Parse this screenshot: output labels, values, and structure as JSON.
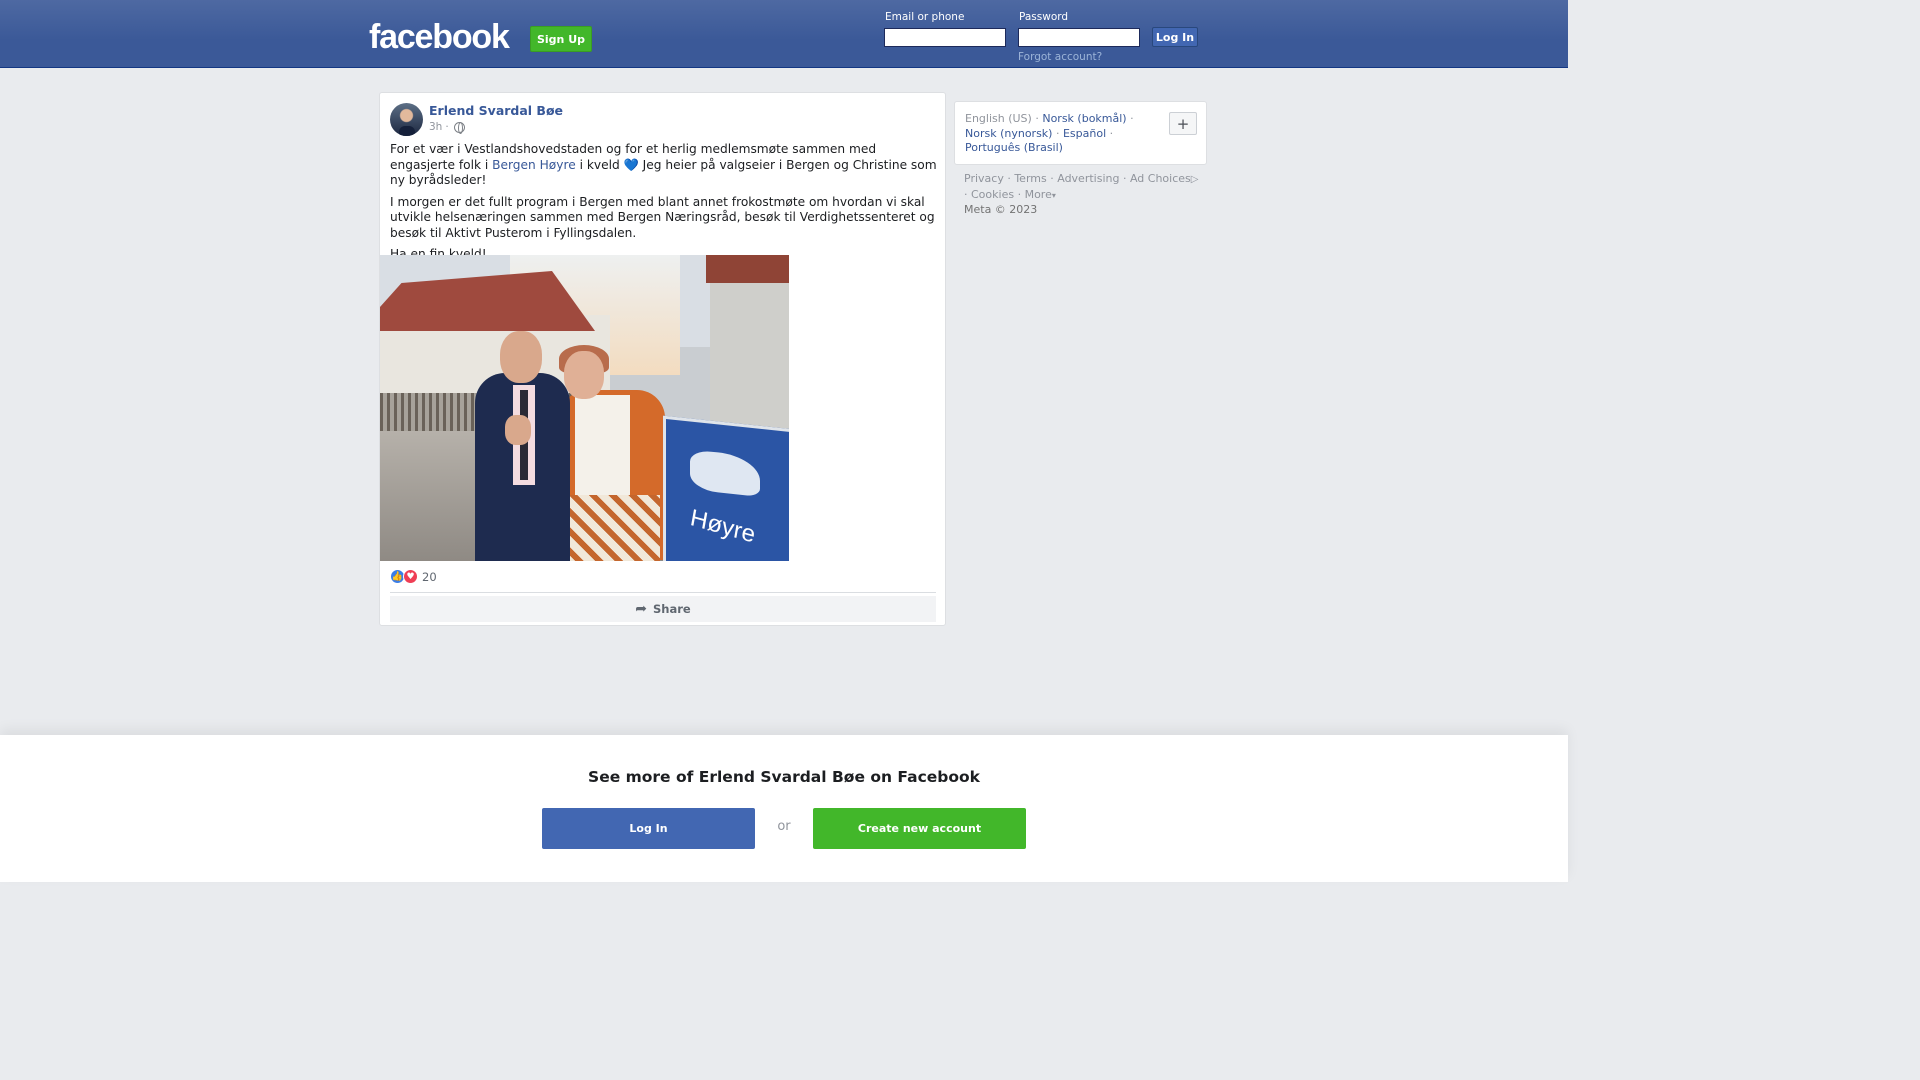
{
  "header": {
    "logo": "facebook",
    "signup_label": "Sign Up",
    "email_label": "Email or phone",
    "email_value": "",
    "password_label": "Password",
    "password_value": "",
    "login_label": "Log In",
    "forgot_label": "Forgot account?"
  },
  "post": {
    "author": "Erlend Svardal Bøe",
    "time": "3h",
    "separator": "·",
    "text_p1_before": "For et vær i Vestlandshovedstaden og for et herlig medlemsmøte sammen med engasjerte folk i ",
    "text_p1_link": "Bergen Høyre",
    "text_p1_mid": " i kveld ",
    "text_p1_emoji": "💙",
    "text_p1_after": " Jeg heier på valgseier i Bergen og Christine som ny byrådsleder!",
    "text_p2": "I morgen er det fullt program i Bergen med blant annet frokostmøte om hvordan vi skal utvikle helsenæringen sammen med Bergen Næringsråd, besøk til Verdighetssenteret og besøk til Aktivt Pusterom i Fyllingsdalen.",
    "text_p3": "Ha en fin kveld!",
    "photo_sign_text": "Høyre",
    "reaction_count": "20",
    "like_glyph": "👍",
    "love_glyph": "♥",
    "share_label": "Share",
    "share_glyph": "➦"
  },
  "sidebar": {
    "languages": [
      "English (US)",
      "Norsk (bokmål)",
      "Norsk (nynorsk)",
      "Español",
      "Português (Brasil)"
    ],
    "dot": "·",
    "add_glyph": "+",
    "footer": {
      "privacy": "Privacy",
      "terms": "Terms",
      "advertising": "Advertising",
      "ad_choices": "Ad Choices",
      "ad_choices_glyph": "▷",
      "cookies": "Cookies",
      "more": "More",
      "more_glyph": "▾",
      "copyright": "Meta © 2023"
    }
  },
  "banner": {
    "title": "See more of Erlend Svardal Bøe on Facebook",
    "login_label": "Log In",
    "or_label": "or",
    "create_label": "Create new account"
  },
  "colors": {
    "brand_blue": "#3b5998",
    "link_blue": "#385898",
    "green": "#42b72a",
    "button_blue": "#4267b2"
  }
}
